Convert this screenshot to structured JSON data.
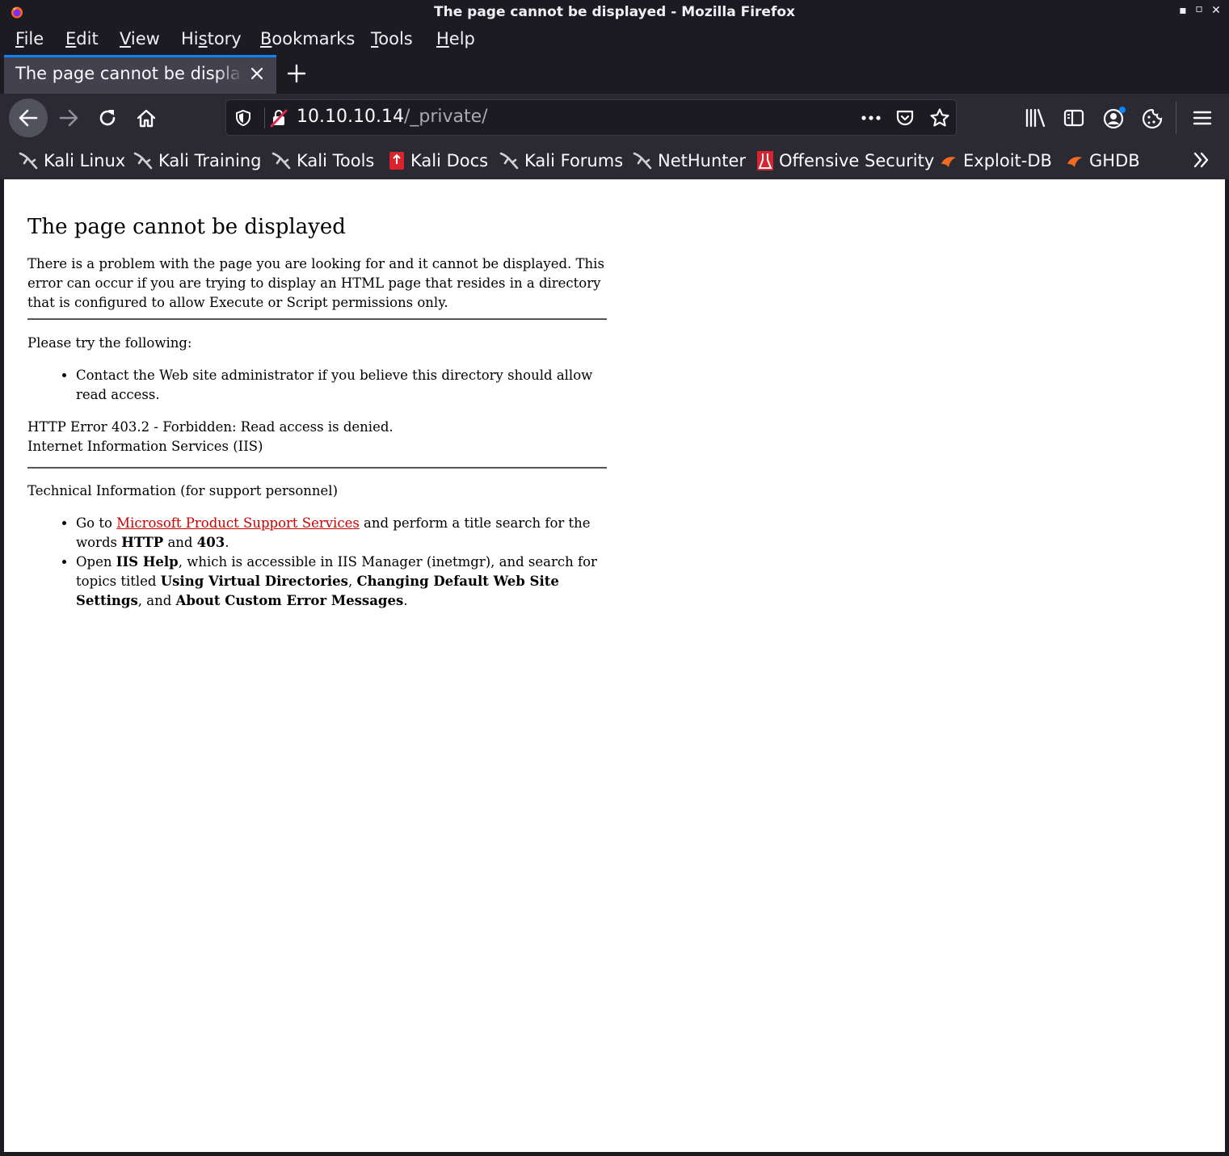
{
  "window": {
    "title": "The page cannot be displayed - Mozilla Firefox",
    "controls": [
      "minimize",
      "maximize",
      "close"
    ]
  },
  "menu": {
    "items": [
      {
        "pre": "",
        "key": "F",
        "post": "ile"
      },
      {
        "pre": "",
        "key": "E",
        "post": "dit"
      },
      {
        "pre": "",
        "key": "V",
        "post": "iew"
      },
      {
        "pre": "Hi",
        "key": "s",
        "post": "tory"
      },
      {
        "pre": "",
        "key": "B",
        "post": "ookmarks"
      },
      {
        "pre": "",
        "key": "T",
        "post": "ools"
      },
      {
        "pre": "",
        "key": "H",
        "post": "elp"
      }
    ]
  },
  "tab": {
    "label": "The page cannot be displayed",
    "accent": "#0a84ff"
  },
  "navbar": {
    "url_host": "10.10.10.14",
    "url_path": "/_private/",
    "icons": [
      "back-icon",
      "forward-icon",
      "reload-icon",
      "home-icon",
      "shield-icon",
      "insecure-lock-icon",
      "page-actions-icon",
      "pocket-icon",
      "star-icon",
      "library-icon",
      "sidebar-icon",
      "account-icon",
      "cookie-icon",
      "menu-icon"
    ]
  },
  "bookmarks": [
    {
      "label": "Kali Linux",
      "icon": "kali-dragon-icon"
    },
    {
      "label": "Kali Training",
      "icon": "kali-dragon-icon"
    },
    {
      "label": "Kali Tools",
      "icon": "kali-dragon-icon"
    },
    {
      "label": "Kali Docs",
      "icon": "kali-docs-icon"
    },
    {
      "label": "Kali Forums",
      "icon": "kali-dragon-icon"
    },
    {
      "label": "NetHunter",
      "icon": "kali-dragon-icon"
    },
    {
      "label": "Offensive Security",
      "icon": "offsec-icon"
    },
    {
      "label": "Exploit-DB",
      "icon": "exploitdb-icon"
    },
    {
      "label": "GHDB",
      "icon": "exploitdb-icon"
    }
  ],
  "page": {
    "heading": "The page cannot be displayed",
    "intro": "There is a problem with the page you are looking for and it cannot be displayed. This error can occur if you are trying to display an HTML page that resides in a directory that is configured to allow Execute or Script permissions only.",
    "try_heading": "Please try the following:",
    "try_items": [
      "Contact the Web site administrator if you believe this directory should allow read access."
    ],
    "error_line": "HTTP Error 403.2 - Forbidden: Read access is denied.",
    "server_line": "Internet Information Services (IIS)",
    "tech_heading": "Technical Information (for support personnel)",
    "tech_item1": {
      "pre": "Go to ",
      "link": "Microsoft Product Support Services",
      "mid": " and perform a title search for the words ",
      "b1": "HTTP",
      "and": " and ",
      "b2": "403",
      "end": "."
    },
    "tech_item2": {
      "pre": "Open ",
      "b1": "IIS Help",
      "mid": ", which is accessible in IIS Manager (inetmgr), and search for topics titled ",
      "b2": "Using Virtual Directories",
      "sep": ", ",
      "b3": "Changing Default Web Site Settings",
      "and": ", and ",
      "b4": "About Custom Error Messages",
      "end": "."
    },
    "link_color": "#cc0000"
  }
}
